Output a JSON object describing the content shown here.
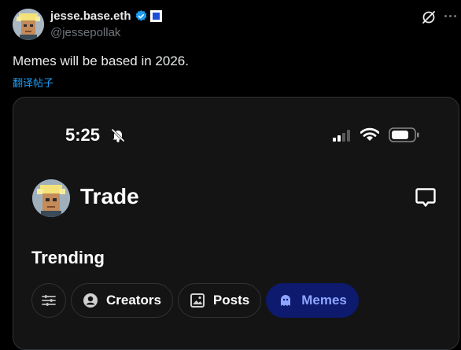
{
  "author": {
    "display_name": "jesse.base.eth",
    "handle": "@jessepollak",
    "avatar_icon": "pixel-avatar-icon",
    "verified_icon": "verified-badge-icon",
    "affiliate_icon": "blue-square-badge-icon"
  },
  "tweet": {
    "text": "Memes will be based in 2026.",
    "translate_label": "翻译帖子"
  },
  "media": {
    "status_bar": {
      "time": "5:25"
    },
    "app": {
      "title": "Trade"
    },
    "section_title": "Trending",
    "filters": [
      {
        "label": "",
        "icon": "sliders-icon",
        "active": false
      },
      {
        "label": "Creators",
        "icon": "person-icon",
        "active": false
      },
      {
        "label": "Posts",
        "icon": "image-icon",
        "active": false
      },
      {
        "label": "Memes",
        "icon": "ghost-icon",
        "active": true
      }
    ]
  },
  "colors": {
    "background": "#000000",
    "link": "#1d9bf0",
    "verified": "#1d9bf0",
    "active_chip": "#0d1a6e",
    "active_chip_text": "#8ea5ff"
  }
}
